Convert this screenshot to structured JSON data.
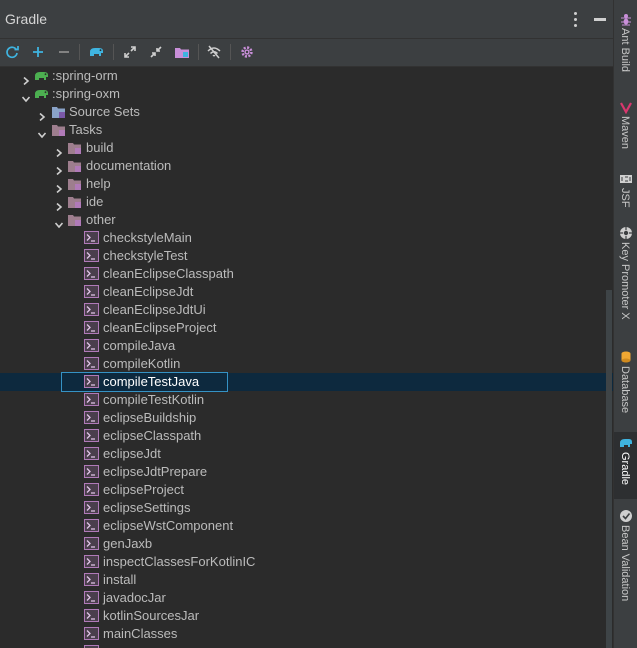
{
  "panel": {
    "title": "Gradle"
  },
  "toolbar": {
    "buttons": [
      {
        "name": "refresh-icon",
        "color": "#3fb4e0"
      },
      {
        "name": "add-icon",
        "color": "#3fb4e0"
      },
      {
        "name": "remove-icon",
        "color": "#8a8a8a"
      },
      {
        "name": "elephant-icon",
        "color": "#3fb4e0"
      },
      {
        "name": "expand-all-icon",
        "color": "#cfcfcf"
      },
      {
        "name": "collapse-all-icon",
        "color": "#cfcfcf"
      },
      {
        "name": "folder-icon",
        "color": "#c98fd9"
      },
      {
        "name": "offline-icon",
        "color": "#cfcfcf"
      },
      {
        "name": "settings-icon",
        "color": "#c98fd9"
      }
    ]
  },
  "tree": [
    {
      "label": ":spring-orm",
      "type": "project",
      "expanded": false,
      "level": 0
    },
    {
      "label": ":spring-oxm",
      "type": "project",
      "expanded": true,
      "level": 0
    },
    {
      "label": "Source Sets",
      "type": "sourceset",
      "expanded": false,
      "level": 1
    },
    {
      "label": "Tasks",
      "type": "folder",
      "expanded": true,
      "level": 1
    },
    {
      "label": "build",
      "type": "folder",
      "expanded": false,
      "level": 2
    },
    {
      "label": "documentation",
      "type": "folder",
      "expanded": false,
      "level": 2
    },
    {
      "label": "help",
      "type": "folder",
      "expanded": false,
      "level": 2
    },
    {
      "label": "ide",
      "type": "folder",
      "expanded": false,
      "level": 2
    },
    {
      "label": "other",
      "type": "folder",
      "expanded": true,
      "level": 2
    },
    {
      "label": "checkstyleMain",
      "type": "task",
      "level": 3
    },
    {
      "label": "checkstyleTest",
      "type": "task",
      "level": 3
    },
    {
      "label": "cleanEclipseClasspath",
      "type": "task",
      "level": 3
    },
    {
      "label": "cleanEclipseJdt",
      "type": "task",
      "level": 3
    },
    {
      "label": "cleanEclipseJdtUi",
      "type": "task",
      "level": 3
    },
    {
      "label": "cleanEclipseProject",
      "type": "task",
      "level": 3
    },
    {
      "label": "compileJava",
      "type": "task",
      "level": 3
    },
    {
      "label": "compileKotlin",
      "type": "task",
      "level": 3
    },
    {
      "label": "compileTestJava",
      "type": "task",
      "level": 3,
      "selected": true
    },
    {
      "label": "compileTestKotlin",
      "type": "task",
      "level": 3
    },
    {
      "label": "eclipseBuildship",
      "type": "task",
      "level": 3
    },
    {
      "label": "eclipseClasspath",
      "type": "task",
      "level": 3
    },
    {
      "label": "eclipseJdt",
      "type": "task",
      "level": 3
    },
    {
      "label": "eclipseJdtPrepare",
      "type": "task",
      "level": 3
    },
    {
      "label": "eclipseProject",
      "type": "task",
      "level": 3
    },
    {
      "label": "eclipseSettings",
      "type": "task",
      "level": 3
    },
    {
      "label": "eclipseWstComponent",
      "type": "task",
      "level": 3
    },
    {
      "label": "genJaxb",
      "type": "task",
      "level": 3
    },
    {
      "label": "inspectClassesForKotlinIC",
      "type": "task",
      "level": 3
    },
    {
      "label": "install",
      "type": "task",
      "level": 3
    },
    {
      "label": "javadocJar",
      "type": "task",
      "level": 3
    },
    {
      "label": "kotlinSourcesJar",
      "type": "task",
      "level": 3
    },
    {
      "label": "mainClasses",
      "type": "task",
      "level": 3
    },
    {
      "label": "",
      "type": "task",
      "level": 3
    }
  ],
  "side_tabs": [
    {
      "label": "Ant Build",
      "icon": "ant-icon"
    },
    {
      "label": "Maven",
      "icon": "maven-icon"
    },
    {
      "label": "JSF",
      "icon": "jsf-icon"
    },
    {
      "label": "Key Promoter X",
      "icon": "key-promoter-icon"
    },
    {
      "label": "Database",
      "icon": "database-icon"
    },
    {
      "label": "Gradle",
      "icon": "gradle-icon",
      "active": true
    },
    {
      "label": "Bean Validation",
      "icon": "bean-validation-icon"
    }
  ],
  "colors": {
    "background": "#2b2b2b",
    "selection": "#0d293e",
    "focus_border": "#3592c4",
    "gradle_green": "#4caf50",
    "task_icon": "#b07ab8"
  }
}
